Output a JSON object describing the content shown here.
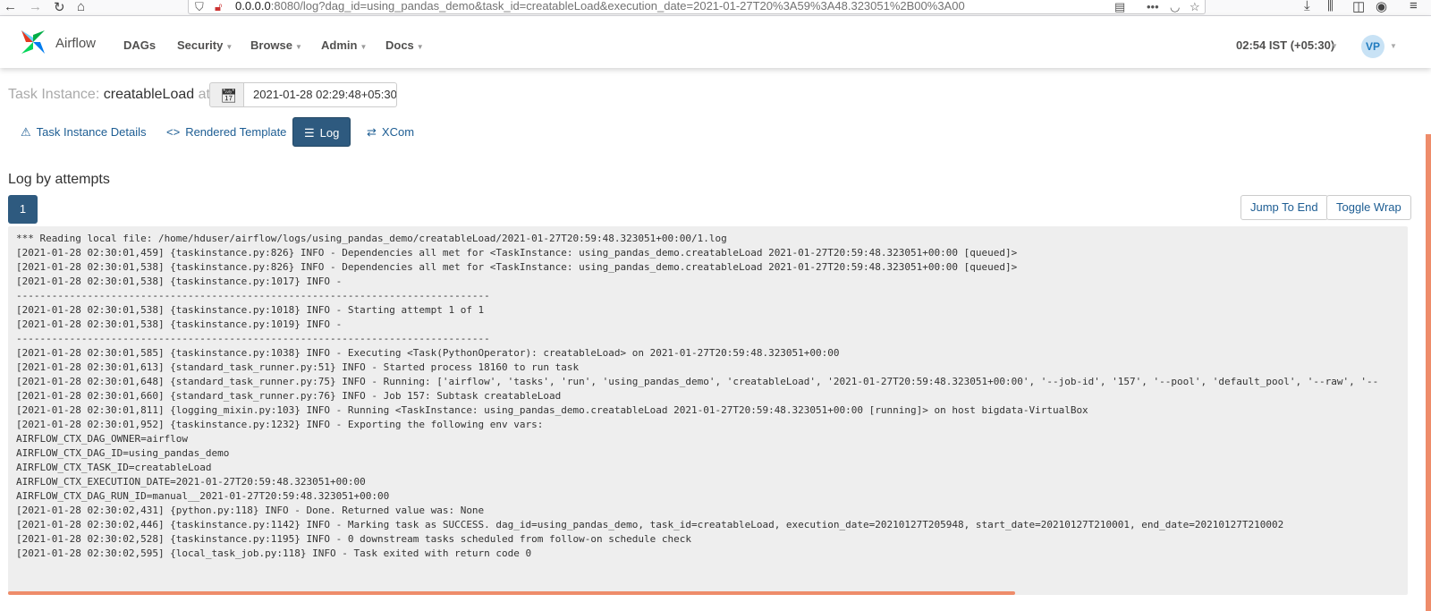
{
  "browser": {
    "url_host": "0.0.0.0",
    "url_rest": ":8080/log?dag_id=using_pandas_demo&task_id=creatableLoad&execution_date=2021-01-27T20%3A59%3A48.323051%2B00%3A00"
  },
  "navbar": {
    "brand": "Airflow",
    "menu": [
      "DAGs",
      "Security",
      "Browse",
      "Admin",
      "Docs"
    ],
    "clock": "02:54 IST (+05:30)",
    "user_initials": "VP"
  },
  "task_instance": {
    "label": "Task Instance:",
    "task_id": "creatableLoad",
    "at": "at",
    "execution_date": "2021-01-28 02:29:48+05:30"
  },
  "tabs": [
    "Task Instance Details",
    "Rendered Template",
    "Log",
    "XCom"
  ],
  "log_section": {
    "title": "Log by attempts",
    "attempt": "1",
    "jump_to_end": "Jump To End",
    "toggle_wrap": "Toggle Wrap"
  },
  "log_lines": [
    "*** Reading local file: /home/hduser/airflow/logs/using_pandas_demo/creatableLoad/2021-01-27T20:59:48.323051+00:00/1.log",
    "[2021-01-28 02:30:01,459] {taskinstance.py:826} INFO - Dependencies all met for <TaskInstance: using_pandas_demo.creatableLoad 2021-01-27T20:59:48.323051+00:00 [queued]>",
    "[2021-01-28 02:30:01,538] {taskinstance.py:826} INFO - Dependencies all met for <TaskInstance: using_pandas_demo.creatableLoad 2021-01-27T20:59:48.323051+00:00 [queued]>",
    "[2021-01-28 02:30:01,538] {taskinstance.py:1017} INFO - ",
    "--------------------------------------------------------------------------------",
    "[2021-01-28 02:30:01,538] {taskinstance.py:1018} INFO - Starting attempt 1 of 1",
    "[2021-01-28 02:30:01,538] {taskinstance.py:1019} INFO - ",
    "--------------------------------------------------------------------------------",
    "[2021-01-28 02:30:01,585] {taskinstance.py:1038} INFO - Executing <Task(PythonOperator): creatableLoad> on 2021-01-27T20:59:48.323051+00:00",
    "[2021-01-28 02:30:01,613] {standard_task_runner.py:51} INFO - Started process 18160 to run task",
    "[2021-01-28 02:30:01,648] {standard_task_runner.py:75} INFO - Running: ['airflow', 'tasks', 'run', 'using_pandas_demo', 'creatableLoad', '2021-01-27T20:59:48.323051+00:00', '--job-id', '157', '--pool', 'default_pool', '--raw', '--",
    "[2021-01-28 02:30:01,660] {standard_task_runner.py:76} INFO - Job 157: Subtask creatableLoad",
    "[2021-01-28 02:30:01,811] {logging_mixin.py:103} INFO - Running <TaskInstance: using_pandas_demo.creatableLoad 2021-01-27T20:59:48.323051+00:00 [running]> on host bigdata-VirtualBox",
    "[2021-01-28 02:30:01,952] {taskinstance.py:1232} INFO - Exporting the following env vars:",
    "AIRFLOW_CTX_DAG_OWNER=airflow",
    "AIRFLOW_CTX_DAG_ID=using_pandas_demo",
    "AIRFLOW_CTX_TASK_ID=creatableLoad",
    "AIRFLOW_CTX_EXECUTION_DATE=2021-01-27T20:59:48.323051+00:00",
    "AIRFLOW_CTX_DAG_RUN_ID=manual__2021-01-27T20:59:48.323051+00:00",
    "[2021-01-28 02:30:02,431] {python.py:118} INFO - Done. Returned value was: None",
    "[2021-01-28 02:30:02,446] {taskinstance.py:1142} INFO - Marking task as SUCCESS. dag_id=using_pandas_demo, task_id=creatableLoad, execution_date=20210127T205948, start_date=20210127T210001, end_date=20210127T210002",
    "[2021-01-28 02:30:02,528] {taskinstance.py:1195} INFO - 0 downstream tasks scheduled from follow-on schedule check",
    "[2021-01-28 02:30:02,595] {local_task_job.py:118} INFO - Task exited with return code 0"
  ],
  "colors": {
    "accent": "#2e5a7f",
    "link": "#1d5d93",
    "scrollbar": "#ee8c6a",
    "log_bg": "#eeeeee"
  }
}
